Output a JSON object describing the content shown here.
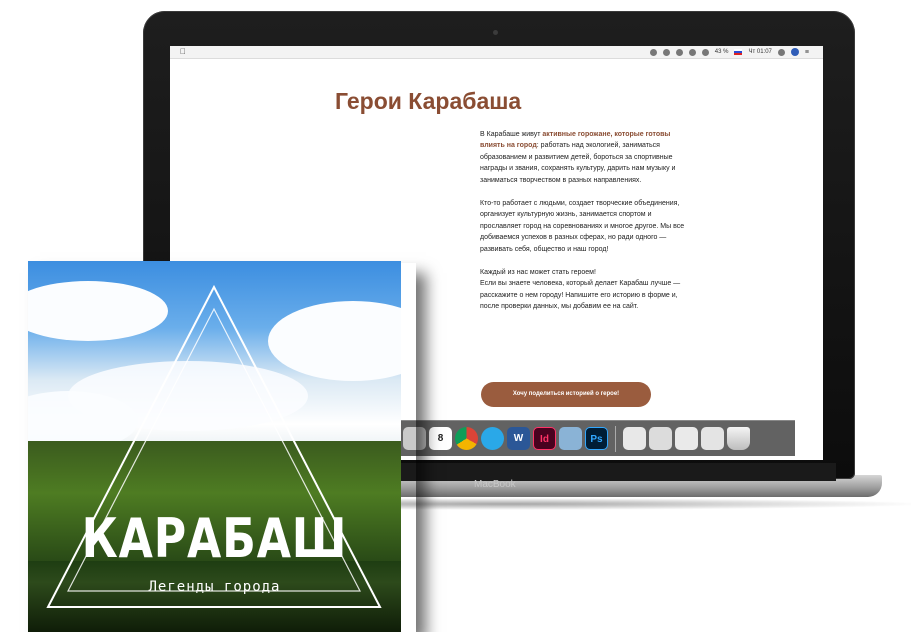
{
  "laptop": {
    "brand": "MacBook",
    "menubar": {
      "battery": "43 %",
      "time": "Чт 01:07"
    }
  },
  "page": {
    "title": "Герои Карабаша",
    "p1_prefix": "В Карабаше живут ",
    "p1_highlight": "активные горожане, которые готовы влиять на город",
    "p1_suffix": ": работать над экологией, заниматься образованием и развитием детей, бороться за спортивные награды и звания, сохранять культуру, дарить нам музыку и заниматься творчеством в разных направлениях.",
    "p2": "Кто-то работает с людьми, создает творческие объединения, организует культурную жизнь, занимается спортом и прославляет город на соревнованиях и многое другое. Мы все добиваемся успехов в разных сферах, но ради одного — развивать себя, общество и наш город!",
    "p3_line1": "Каждый из нас может стать героем!",
    "p3_rest": "Если вы знаете человека, который делает Карабаш лучше — расскажите о нем городу! Напишите его историю в форме и, после проверки данных, мы добавим ее на сайт.",
    "share_button": "Хочу поделиться историей о герое!"
  },
  "dock": {
    "items": [
      {
        "name": "photos-icon",
        "label": ""
      },
      {
        "name": "calendar-icon",
        "label": "8"
      },
      {
        "name": "chrome-icon",
        "label": ""
      },
      {
        "name": "browser-icon",
        "label": ""
      },
      {
        "name": "word-icon",
        "label": "W"
      },
      {
        "name": "indesign-icon",
        "label": "Id"
      },
      {
        "name": "preview-icon",
        "label": ""
      },
      {
        "name": "photoshop-icon",
        "label": "Ps"
      },
      {
        "name": "window-icon",
        "label": ""
      },
      {
        "name": "window-icon",
        "label": ""
      },
      {
        "name": "window-icon",
        "label": ""
      },
      {
        "name": "window-icon",
        "label": ""
      },
      {
        "name": "trash-icon",
        "label": ""
      }
    ]
  },
  "poster": {
    "title": "КАРАБАШ",
    "subtitle": "Легенды города"
  },
  "colors": {
    "accent": "#8a4d33",
    "button": "#9a5c3e"
  }
}
